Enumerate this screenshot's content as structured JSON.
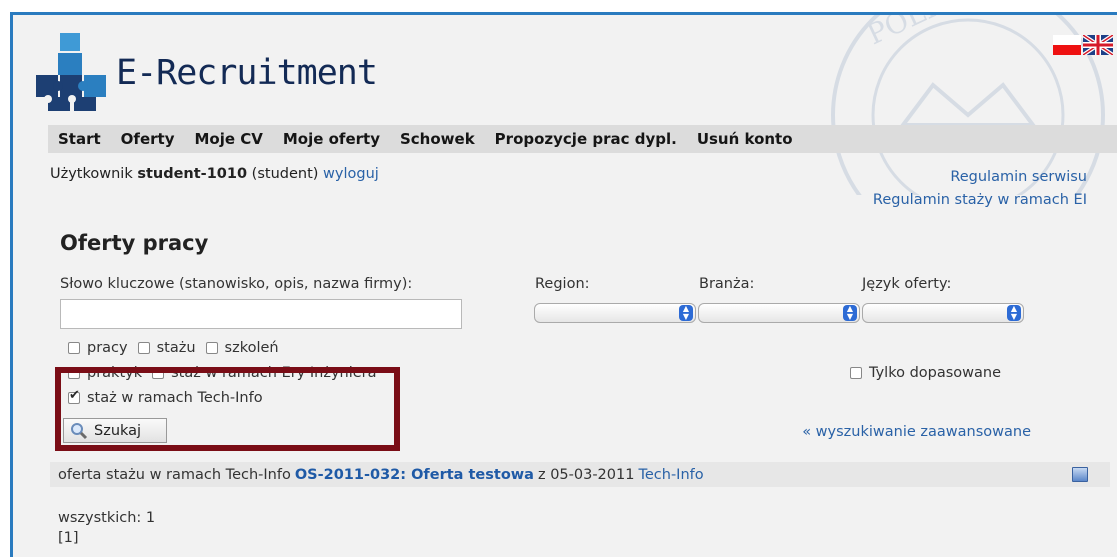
{
  "header": {
    "app_title": "E-Recruitment",
    "languages": [
      "pl-flag",
      "en-flag"
    ]
  },
  "nav": {
    "items": [
      "Start",
      "Oferty",
      "Moje CV",
      "Moje oferty",
      "Schowek",
      "Propozycje prac dypl.",
      "Usuń konto"
    ]
  },
  "user": {
    "prefix": "Użytkownik",
    "name": "student-1010",
    "role": "(student)",
    "logout": "wyloguj"
  },
  "links": {
    "rules": "Regulamin serwisu",
    "internship_rules": "Regulamin staży w ramach EI"
  },
  "page": {
    "title": "Oferty pracy"
  },
  "filters": {
    "keyword_label": "Słowo kluczowe (stanowisko, opis, nazwa firmy):",
    "keyword_value": "",
    "region_label": "Region:",
    "industry_label": "Branża:",
    "language_label": "Język oferty:",
    "type_checkboxes": [
      {
        "label": "pracy",
        "checked": false
      },
      {
        "label": "stażu",
        "checked": false
      },
      {
        "label": "szkoleń",
        "checked": false
      }
    ],
    "extra_checkboxes": [
      {
        "label": "praktyk",
        "checked": false
      },
      {
        "label": "staż w ramach Ery Inżyniera",
        "checked": false
      }
    ],
    "tech_info": {
      "label": "staż w ramach Tech-Info",
      "checked": true
    },
    "only_matched": {
      "label": "Tylko dopasowane",
      "checked": false
    },
    "search_button": "Szukaj",
    "advanced_link": "« wyszukiwanie zaawansowane"
  },
  "results": [
    {
      "prefix": "oferta stażu w ramach Tech-Info",
      "offer_id_title": "OS-2011-032: Oferta testowa",
      "date_text": "z 05-03-2011",
      "company": "Tech-Info"
    }
  ],
  "summary": {
    "total": "wszystkich: 1",
    "pages": "[1]"
  },
  "colors": {
    "accent_border": "#7a0d16",
    "link": "#2a62a7",
    "frame": "#2a7bbf"
  }
}
